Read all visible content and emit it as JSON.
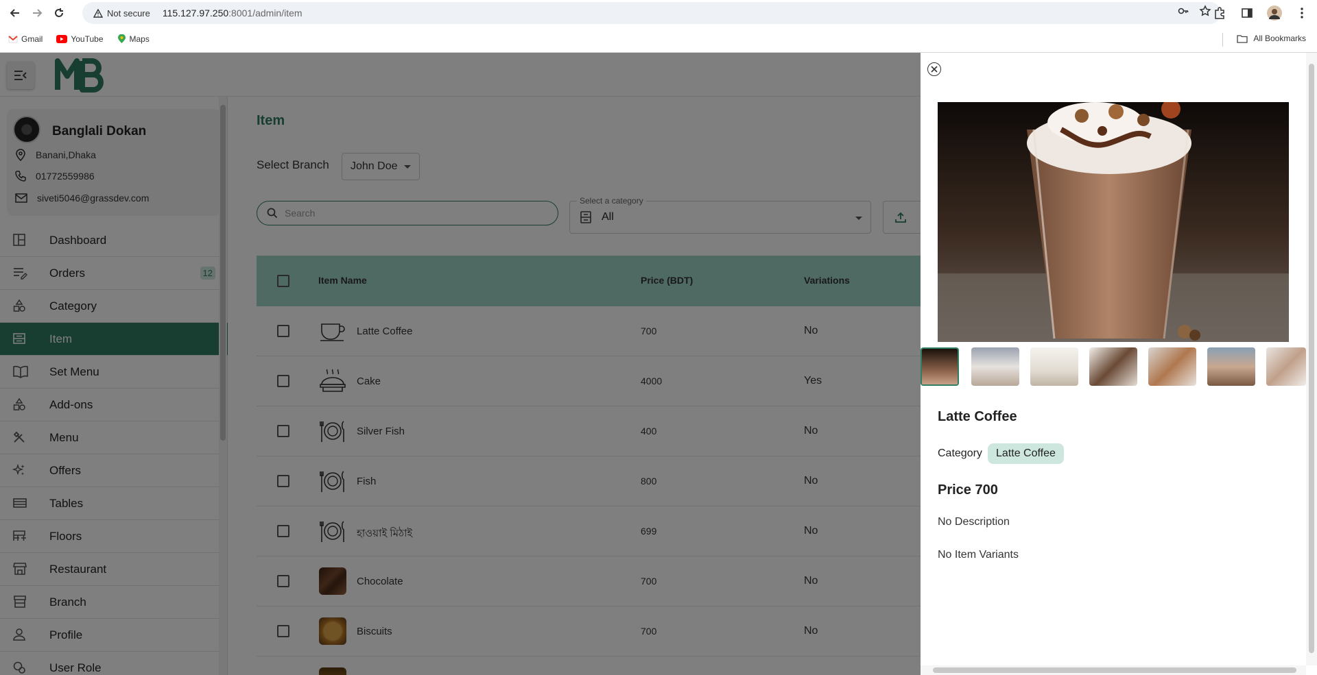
{
  "browser": {
    "security_label": "Not secure",
    "url_host": "115.127.97.250",
    "url_rest": ":8001/admin/item",
    "bookmarks": [
      "Gmail",
      "YouTube",
      "Maps"
    ],
    "all_bookmarks": "All Bookmarks"
  },
  "header": {
    "logo_text": "MB"
  },
  "profile": {
    "shop_name": "Banglali Dokan",
    "address": "Banani,Dhaka",
    "phone": "01772559986",
    "email": "siveti5046@grassdev.com"
  },
  "sidebar": {
    "items": [
      {
        "label": "Dashboard"
      },
      {
        "label": "Orders",
        "badge": "12"
      },
      {
        "label": "Category"
      },
      {
        "label": "Item"
      },
      {
        "label": "Set Menu"
      },
      {
        "label": "Add-ons"
      },
      {
        "label": "Menu"
      },
      {
        "label": "Offers"
      },
      {
        "label": "Tables"
      },
      {
        "label": "Floors"
      },
      {
        "label": "Restaurant"
      },
      {
        "label": "Branch"
      },
      {
        "label": "Profile"
      },
      {
        "label": "User Role"
      }
    ],
    "active": "Item"
  },
  "main": {
    "title": "Item",
    "select_branch_label": "Select Branch",
    "branch_value": "John Doe",
    "search_placeholder": "Search",
    "category_legend": "Select a category",
    "category_value": "All"
  },
  "table": {
    "headers": {
      "name": "Item Name",
      "price": "Price (BDT)",
      "variations": "Variations"
    },
    "rows": [
      {
        "name": "Latte Coffee",
        "price": "700",
        "variations": "No",
        "icon": "cup-icon"
      },
      {
        "name": "Cake",
        "price": "4000",
        "variations": "Yes",
        "icon": "cake-icon"
      },
      {
        "name": "Silver Fish",
        "price": "400",
        "variations": "No",
        "icon": "dish-icon"
      },
      {
        "name": "Fish",
        "price": "800",
        "variations": "No",
        "icon": "dish-icon"
      },
      {
        "name": "হাওয়াই মিঠাই",
        "price": "699",
        "variations": "No",
        "icon": "dish-icon"
      },
      {
        "name": "Chocolate",
        "price": "700",
        "variations": "No",
        "icon": "chocolate-photo"
      },
      {
        "name": "Biscuits",
        "price": "700",
        "variations": "No",
        "icon": "biscuit-photo"
      }
    ]
  },
  "drawer": {
    "title": "Latte Coffee",
    "category_label": "Category",
    "category_chip": "Latte Coffee",
    "price": "Price 700",
    "description": "No Description",
    "variants": "No Item Variants"
  },
  "colors": {
    "accent": "#2f7d63",
    "table_header": "#9fd2c6",
    "chip": "#cde7df"
  }
}
